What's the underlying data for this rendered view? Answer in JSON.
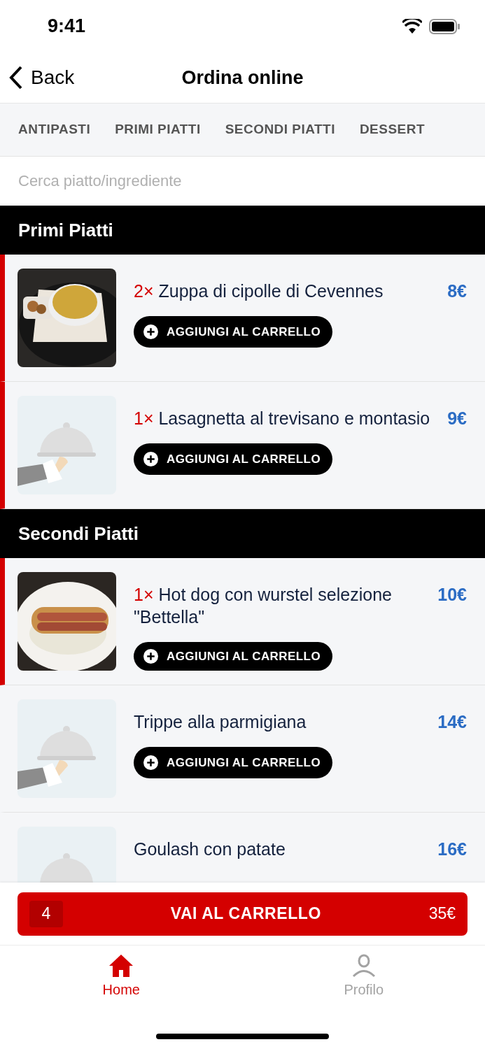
{
  "status_bar": {
    "time": "9:41"
  },
  "nav": {
    "back": "Back",
    "title": "Ordina online"
  },
  "tabs": [
    {
      "label": "ANTIPASTI",
      "selected": false
    },
    {
      "label": "PRIMI PIATTI",
      "selected": false
    },
    {
      "label": "SECONDI PIATTI",
      "selected": false
    },
    {
      "label": "DESSERT",
      "selected": false
    }
  ],
  "search": {
    "placeholder": "Cerca piatto/ingrediente"
  },
  "sections": [
    {
      "title": "Primi Piatti",
      "items": [
        {
          "quantity": "2×",
          "name": "Zuppa di cipolle di Cevennes",
          "price": "8€",
          "in_cart": true,
          "kind": "soup",
          "button": "AGGIUNGI AL CARRELLO"
        },
        {
          "quantity": "1×",
          "name": "Lasagnetta al trevisano e montasio",
          "price": "9€",
          "in_cart": true,
          "kind": "placeholder",
          "button": "AGGIUNGI AL CARRELLO"
        }
      ]
    },
    {
      "title": "Secondi Piatti",
      "items": [
        {
          "quantity": "1×",
          "name": "Hot dog con wurstel selezione \"Bettella\"",
          "price": "10€",
          "in_cart": true,
          "kind": "hotdog",
          "button": "AGGIUNGI AL CARRELLO"
        },
        {
          "name": "Trippe alla parmigiana",
          "price": "14€",
          "in_cart": false,
          "kind": "placeholder",
          "button": "AGGIUNGI AL CARRELLO"
        },
        {
          "name": "Goulash con patate",
          "price": "16€",
          "in_cart": false,
          "kind": "placeholder"
        }
      ]
    }
  ],
  "cart": {
    "count": "4",
    "label": "VAI AL CARRELLO",
    "total": "35€"
  },
  "bottom_tabs": [
    {
      "label": "Home",
      "kind": "home",
      "selected": true
    },
    {
      "label": "Profilo",
      "kind": "user",
      "selected": false
    }
  ]
}
